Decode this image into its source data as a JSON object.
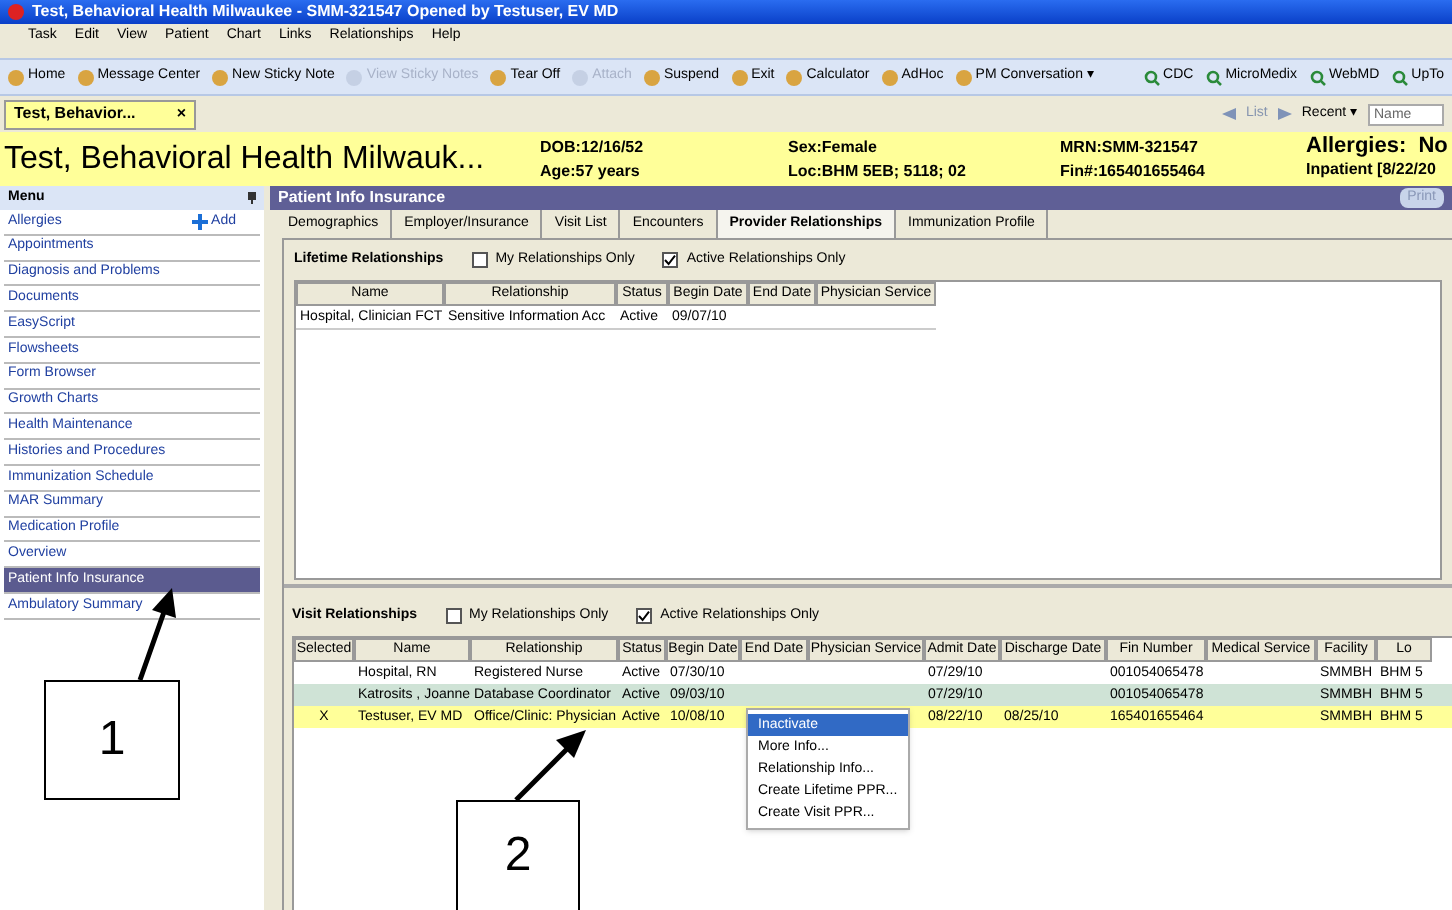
{
  "window": {
    "title": "Test, Behavioral Health Milwaukee - SMM-321547 Opened by Testuser, EV MD"
  },
  "menu_bar": [
    "Task",
    "Edit",
    "View",
    "Patient",
    "Chart",
    "Links",
    "Relationships",
    "Help"
  ],
  "toolbar": [
    {
      "label": "Home",
      "disabled": false
    },
    {
      "label": "Message Center",
      "disabled": false
    },
    {
      "label": "New Sticky Note",
      "disabled": false
    },
    {
      "label": "View Sticky Notes",
      "disabled": true
    },
    {
      "label": "Tear Off",
      "disabled": false
    },
    {
      "label": "Attach",
      "disabled": true
    },
    {
      "label": "Suspend",
      "disabled": false
    },
    {
      "label": "Exit",
      "disabled": false
    },
    {
      "label": "Calculator",
      "disabled": false
    },
    {
      "label": "AdHoc",
      "disabled": false
    },
    {
      "label": "PM Conversation ▾",
      "disabled": false
    }
  ],
  "links_toolbar": [
    "CDC",
    "MicroMedix",
    "WebMD",
    "UpTo"
  ],
  "patient_tab": {
    "label": "Test, Behavior...",
    "close": "×"
  },
  "nav": {
    "list": "List",
    "recent": "Recent ▾",
    "search_placeholder": "Name"
  },
  "banner": {
    "name": "Test, Behavioral Health Milwauk...",
    "dob": "DOB:12/16/52",
    "age": "Age:57 years",
    "sex": "Sex:Female",
    "loc": "Loc:BHM 5EB; 5118; 02",
    "mrn": "MRN:SMM-321547",
    "fin": "Fin#:165401655464",
    "allergies": "Allergies:  No",
    "status": "Inpatient [8/22/20"
  },
  "sidebar": {
    "title": "Menu",
    "add": "Add",
    "items": [
      {
        "label": "Allergies",
        "selected": false
      },
      {
        "label": "Appointments",
        "selected": false
      },
      {
        "label": "Diagnosis and Problems",
        "selected": false
      },
      {
        "label": "Documents",
        "selected": false
      },
      {
        "label": "EasyScript",
        "selected": false
      },
      {
        "label": "Flowsheets",
        "selected": false
      },
      {
        "label": "Form Browser",
        "selected": false
      },
      {
        "label": "Growth Charts",
        "selected": false
      },
      {
        "label": "Health Maintenance",
        "selected": false
      },
      {
        "label": "Histories and Procedures",
        "selected": false
      },
      {
        "label": "Immunization Schedule",
        "selected": false
      },
      {
        "label": "MAR Summary",
        "selected": false
      },
      {
        "label": "Medication Profile",
        "selected": false
      },
      {
        "label": "Overview",
        "selected": false
      },
      {
        "label": "Patient Info Insurance",
        "selected": true
      },
      {
        "label": "Ambulatory Summary",
        "selected": false
      }
    ]
  },
  "content": {
    "title": "Patient Info Insurance",
    "print": "Print",
    "tabs": [
      {
        "label": "Demographics",
        "selected": false
      },
      {
        "label": "Employer/Insurance",
        "selected": false
      },
      {
        "label": "Visit List",
        "selected": false
      },
      {
        "label": "Encounters",
        "selected": false
      },
      {
        "label": "Provider Relationships",
        "selected": true
      },
      {
        "label": "Immunization Profile",
        "selected": false
      }
    ],
    "lifetime": {
      "title": "Lifetime Relationships",
      "filters": [
        {
          "label": "My Relationships Only",
          "checked": false
        },
        {
          "label": "Active Relationships Only",
          "checked": true
        }
      ],
      "columns": [
        "Name",
        "Relationship",
        "Status",
        "Begin Date",
        "End Date",
        "Physician Service"
      ],
      "rows": [
        [
          "Hospital, Clinician FCT",
          "Sensitive Information Acc",
          "Active",
          "09/07/10",
          "",
          ""
        ]
      ]
    },
    "visit": {
      "title": "Visit Relationships",
      "filters": [
        {
          "label": "My Relationships Only",
          "checked": false
        },
        {
          "label": "Active Relationships Only",
          "checked": true
        }
      ],
      "columns": [
        "Selected",
        "Name",
        "Relationship",
        "Status",
        "Begin Date",
        "End Date",
        "Physician Service",
        "Admit Date",
        "Discharge Date",
        "Fin Number",
        "Medical Service",
        "Facility",
        "Lo"
      ],
      "rows": [
        {
          "color": "#ffffff",
          "cells": [
            "",
            "Hospital, RN",
            "Registered Nurse",
            "Active",
            "07/30/10",
            "",
            "",
            "07/29/10",
            "",
            "001054065478",
            "",
            "SMMBH",
            "BHM 5"
          ]
        },
        {
          "color": "#cfe3d6",
          "cells": [
            "",
            "Katrosits , Joanne",
            "Database Coordinator",
            "Active",
            "09/03/10",
            "",
            "",
            "07/29/10",
            "",
            "001054065478",
            "",
            "SMMBH",
            "BHM 5"
          ]
        },
        {
          "color": "#ffff99",
          "cells": [
            "X",
            "Testuser, EV MD",
            "Office/Clinic: Physician",
            "Active",
            "10/08/10",
            "",
            "",
            "08/22/10",
            "08/25/10",
            "165401655464",
            "",
            "SMMBH",
            "BHM 5"
          ]
        }
      ]
    }
  },
  "context_menu": [
    {
      "label": "Inactivate",
      "selected": true
    },
    {
      "label": "More Info...",
      "selected": false
    },
    {
      "label": "Relationship Info...",
      "selected": false
    },
    {
      "label": "Create Lifetime PPR...",
      "selected": false
    },
    {
      "label": "Create Visit PPR...",
      "selected": false
    }
  ],
  "callouts": [
    "1",
    "2"
  ]
}
